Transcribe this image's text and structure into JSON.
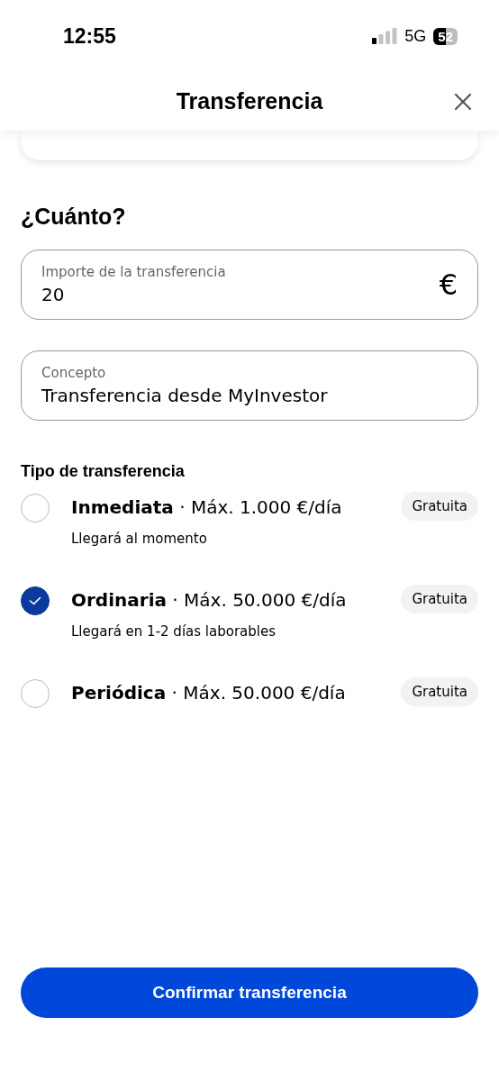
{
  "status_bar": {
    "time": "12:55",
    "network": "5G",
    "battery": "52"
  },
  "header": {
    "title": "Transferencia"
  },
  "section_title": "¿Cuánto?",
  "fields": [
    {
      "label": "Importe de la transferencia",
      "value": "20",
      "suffix": "€"
    },
    {
      "label": "Concepto",
      "value": "Transferencia desde MyInvestor"
    }
  ],
  "type_title": "Tipo de transferencia",
  "options": [
    {
      "text": "**Inmediata** · Máx. 1.000 €/día",
      "note": "Llegará al momento",
      "badge": "Gratuita",
      "selected": false
    },
    {
      "text": "**Ordinaria** · Máx. 50.000 €/día",
      "note": "Llegará en 1-2 días laborables",
      "badge": "Gratuita",
      "selected": true
    },
    {
      "text": "**Periódica** · Máx. 50.000 €/día",
      "badge": "Gratuita",
      "selected": false
    }
  ],
  "confirm_button": "Confirmar transferencia"
}
